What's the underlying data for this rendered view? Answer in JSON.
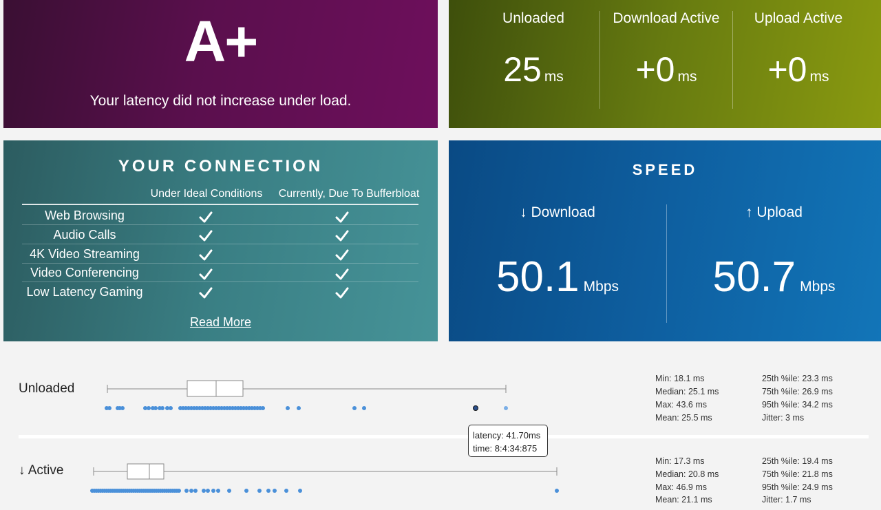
{
  "grade": {
    "value": "A+",
    "message": "Your latency did not increase under load."
  },
  "latency_summary": [
    {
      "label": "Unloaded",
      "value": "25",
      "unit": "ms"
    },
    {
      "label": "Download Active",
      "value": "+0",
      "unit": "ms"
    },
    {
      "label": "Upload Active",
      "value": "+0",
      "unit": "ms"
    }
  ],
  "connection": {
    "title": "YOUR CONNECTION",
    "col_ideal": "Under Ideal Conditions",
    "col_current": "Currently, Due To Bufferbloat",
    "rows": [
      {
        "label": "Web Browsing"
      },
      {
        "label": "Audio Calls"
      },
      {
        "label": "4K Video Streaming"
      },
      {
        "label": "Video Conferencing"
      },
      {
        "label": "Low Latency Gaming"
      }
    ],
    "read_more": "Read More"
  },
  "speed": {
    "title": "SPEED",
    "download": {
      "label": "↓ Download",
      "value": "50.1",
      "unit": "Mbps"
    },
    "upload": {
      "label": "↑ Upload",
      "value": "50.7",
      "unit": "Mbps"
    }
  },
  "colors": {
    "dot": "#4a90d9",
    "box_stroke": "#888888"
  },
  "latency_plots": {
    "unloaded": {
      "label": "Unloaded",
      "stats_left": [
        "Min: 18.1 ms",
        "Median: 25.1 ms",
        "Max: 43.6 ms",
        "Mean: 25.5 ms"
      ],
      "stats_right": [
        "25th %ile: 23.3 ms",
        "75th %ile: 26.9 ms",
        "95th %ile: 34.2 ms",
        "Jitter: 3 ms"
      ]
    },
    "active": {
      "label": "↓ Active",
      "stats_left": [
        "Min: 17.3 ms",
        "Median: 20.8 ms",
        "Max: 46.9 ms",
        "Mean: 21.1 ms"
      ],
      "stats_right": [
        "25th %ile: 19.4 ms",
        "75th %ile: 21.8 ms",
        "95th %ile: 24.9 ms",
        "Jitter: 1.7 ms"
      ]
    }
  },
  "tooltip": {
    "latency": "latency: 41.70ms",
    "time": "time: 8:4:34:875"
  }
}
